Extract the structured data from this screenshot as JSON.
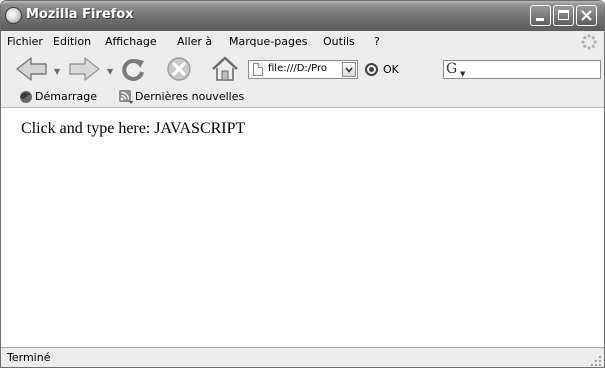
{
  "window": {
    "title": "Mozilla Firefox"
  },
  "menubar": {
    "items": [
      "Fichier",
      "Edition",
      "Affichage",
      "Aller à",
      "Marque-pages",
      "Outils",
      "?"
    ]
  },
  "navbar": {
    "url": "file:///D:/Pro",
    "go_label": "OK",
    "search_value": ""
  },
  "bookmarks": {
    "items": [
      "Démarrage",
      "Dernières nouvelles"
    ]
  },
  "content": {
    "text": "Click and type here: JAVASCRIPT"
  },
  "statusbar": {
    "text": "Terminé"
  },
  "icons": [
    "firefox-icon",
    "back-icon",
    "forward-icon",
    "reload-icon",
    "stop-icon",
    "home-icon",
    "page-icon",
    "go-icon",
    "search-engine-icon",
    "throbber-icon",
    "bookmark-icon",
    "rss-icon",
    "resize-grip-icon"
  ]
}
